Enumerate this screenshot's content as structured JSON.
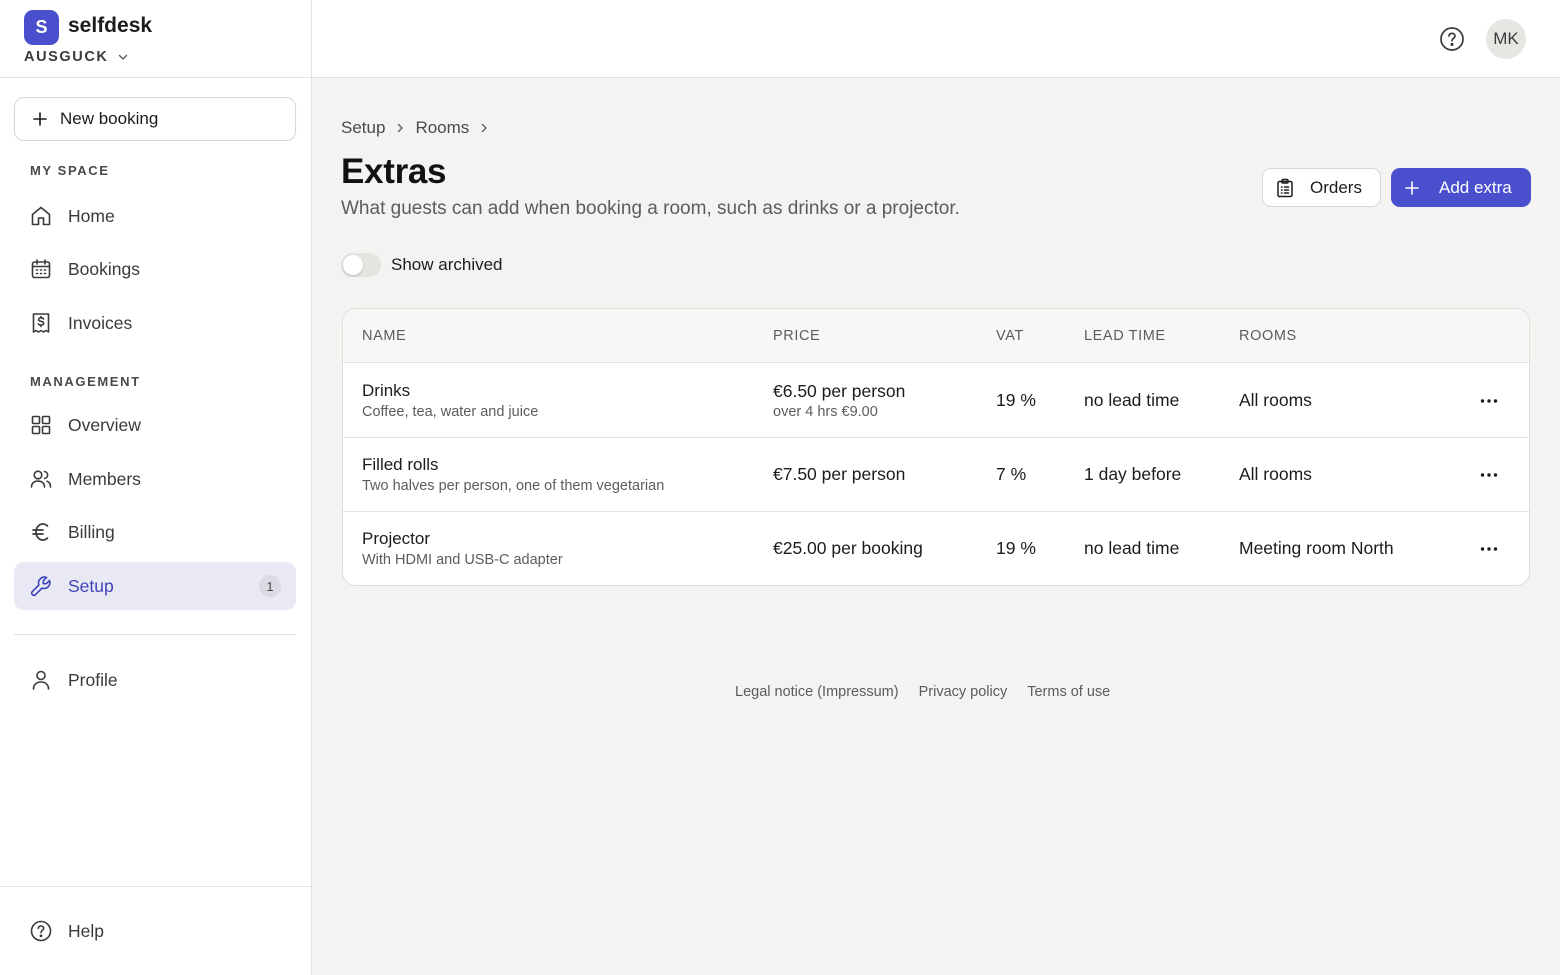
{
  "brand": {
    "logo_letter": "S",
    "name": "selfdesk",
    "workspace": "AUSGUCK"
  },
  "sidebar": {
    "new_booking_label": "New booking",
    "my_space_label": "MY SPACE",
    "my_space_items": [
      {
        "label": "Home",
        "icon": "home-icon"
      },
      {
        "label": "Bookings",
        "icon": "calendar-icon"
      },
      {
        "label": "Invoices",
        "icon": "invoice-icon"
      }
    ],
    "management_label": "MANAGEMENT",
    "management_items": [
      {
        "label": "Overview",
        "icon": "grid-icon"
      },
      {
        "label": "Members",
        "icon": "users-icon"
      },
      {
        "label": "Billing",
        "icon": "euro-icon"
      },
      {
        "label": "Setup",
        "icon": "wrench-icon",
        "active": true,
        "badge": "1"
      }
    ],
    "profile_label": "Profile",
    "help_label": "Help"
  },
  "topbar": {
    "avatar_initials": "MK"
  },
  "breadcrumb": [
    "Setup",
    "Rooms"
  ],
  "page": {
    "title": "Extras",
    "description": "What guests can add when booking a room, such as drinks or a projector.",
    "orders_label": "Orders",
    "add_label": "Add extra",
    "show_archived_label": "Show archived",
    "show_archived_on": false
  },
  "table": {
    "headers": [
      "NAME",
      "PRICE",
      "VAT",
      "LEAD TIME",
      "ROOMS"
    ],
    "rows": [
      {
        "name": "Drinks",
        "description": "Coffee, tea, water and juice",
        "price": "€6.50 per person",
        "price_note": "over 4 hrs €9.00",
        "vat": "19 %",
        "lead_time": "no lead time",
        "rooms": "All rooms"
      },
      {
        "name": "Filled rolls",
        "description": "Two halves per person, one of them vegetarian",
        "price": "€7.50 per person",
        "price_note": "",
        "vat": "7 %",
        "lead_time": "1 day before",
        "rooms": "All rooms"
      },
      {
        "name": "Projector",
        "description": "With HDMI and USB-C adapter",
        "price": "€25.00 per booking",
        "price_note": "",
        "vat": "19 %",
        "lead_time": "no lead time",
        "rooms": "Meeting room North"
      }
    ]
  },
  "footer": {
    "links": [
      "Legal notice (Impressum)",
      "Privacy policy",
      "Terms of use"
    ]
  },
  "colors": {
    "accent": "#4a4fce",
    "active_bg": "#e9e9f6",
    "page_bg": "#f4f3f1"
  }
}
